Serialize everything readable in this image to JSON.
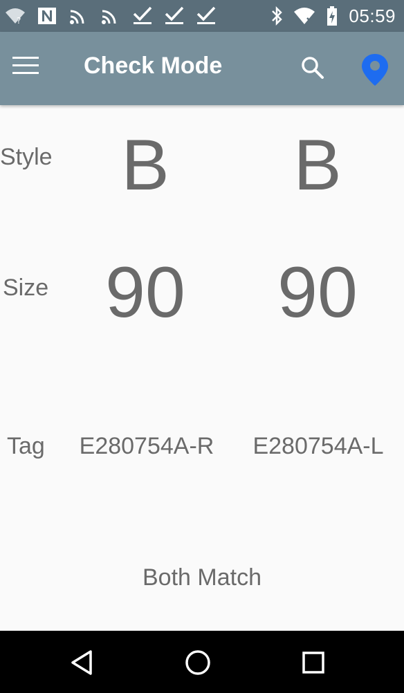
{
  "status_bar": {
    "time": "05:59",
    "icons": [
      "wifi-unknown-icon",
      "n-icon",
      "cast-icon",
      "cast-icon",
      "check-download-icon",
      "check-download-icon",
      "check-download-icon",
      "bluetooth-icon",
      "wifi-no-internet-icon",
      "battery-charging-icon"
    ]
  },
  "app_bar": {
    "title": "Check Mode",
    "icons": [
      "menu-icon",
      "search-icon",
      "location-pin-icon"
    ],
    "accent_color": "#1e6cf0"
  },
  "fields": {
    "style": {
      "label": "Style",
      "right": "B",
      "left": "B"
    },
    "size": {
      "label": "Size",
      "right": "90",
      "left": "90"
    },
    "tag": {
      "label": "Tag",
      "right": "E280754A-R",
      "left": "E280754A-L"
    }
  },
  "result": {
    "text": "Both Match"
  },
  "nav_bar": {
    "icons": [
      "back-icon",
      "home-icon",
      "recents-icon"
    ]
  }
}
